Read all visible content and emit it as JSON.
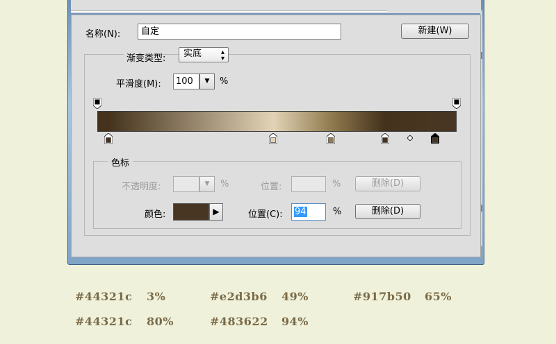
{
  "dialog": {
    "name_label": "名称(N):",
    "name_value": "自定",
    "new_button": "新建(W)",
    "gradient_type_label": "渐变类型:",
    "gradient_type_value": "实底",
    "smoothness_label": "平滑度(M):",
    "smoothness_value": "100",
    "smoothness_unit": "%"
  },
  "gradient": {
    "stops": [
      {
        "color": "#44321c",
        "location": 3
      },
      {
        "color": "#e2d3b6",
        "location": 49
      },
      {
        "color": "#917b50",
        "location": 65
      },
      {
        "color": "#44321c",
        "location": 80
      },
      {
        "color": "#483622",
        "location": 94
      }
    ],
    "opacity_stops": [
      {
        "location": 0
      },
      {
        "location": 100
      }
    ],
    "midpoint_location": 87,
    "selected_stop": 4
  },
  "color_stops_group": {
    "title": "色标",
    "opacity_label": "不透明度:",
    "opacity_unit": "%",
    "location_label_top": "位置:",
    "location_unit_top": "%",
    "delete_top": "删除(D)",
    "color_label": "颜色:",
    "color_swatch": "#483622",
    "location_label": "位置(C):",
    "location_value": "94",
    "location_unit": "%",
    "delete_bottom": "删除(D)"
  },
  "legend": [
    {
      "hex": "#44321c",
      "pct": "3%"
    },
    {
      "hex": "#e2d3b6",
      "pct": "49%"
    },
    {
      "hex": "#917b50",
      "pct": "65%"
    },
    {
      "hex": "#44321c",
      "pct": "80%"
    },
    {
      "hex": "#483622",
      "pct": "94%"
    }
  ]
}
